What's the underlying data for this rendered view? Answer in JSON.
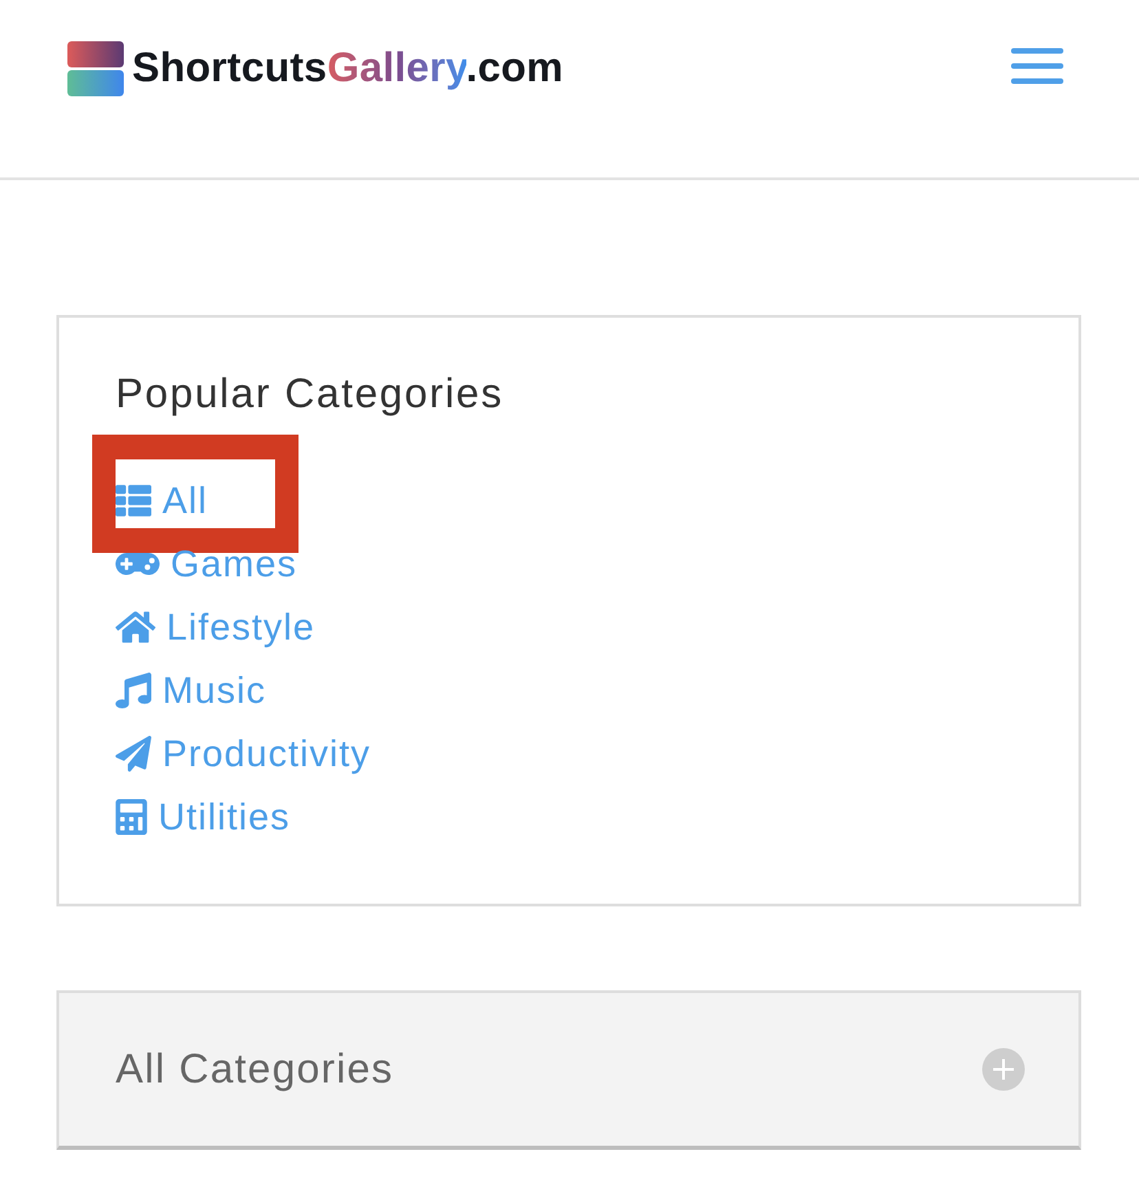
{
  "header": {
    "logo": {
      "text": "Shortcuts",
      "accent": "Gallery",
      "suffix": ".com"
    }
  },
  "popular_categories": {
    "title": "Popular Categories",
    "items": [
      {
        "label": "All",
        "highlighted": true
      },
      {
        "label": "Games",
        "highlighted": false
      },
      {
        "label": "Lifestyle",
        "highlighted": false
      },
      {
        "label": "Music",
        "highlighted": false
      },
      {
        "label": "Productivity",
        "highlighted": false
      },
      {
        "label": "Utilities",
        "highlighted": false
      }
    ]
  },
  "all_categories": {
    "title": "All Categories",
    "expanded": false
  }
}
